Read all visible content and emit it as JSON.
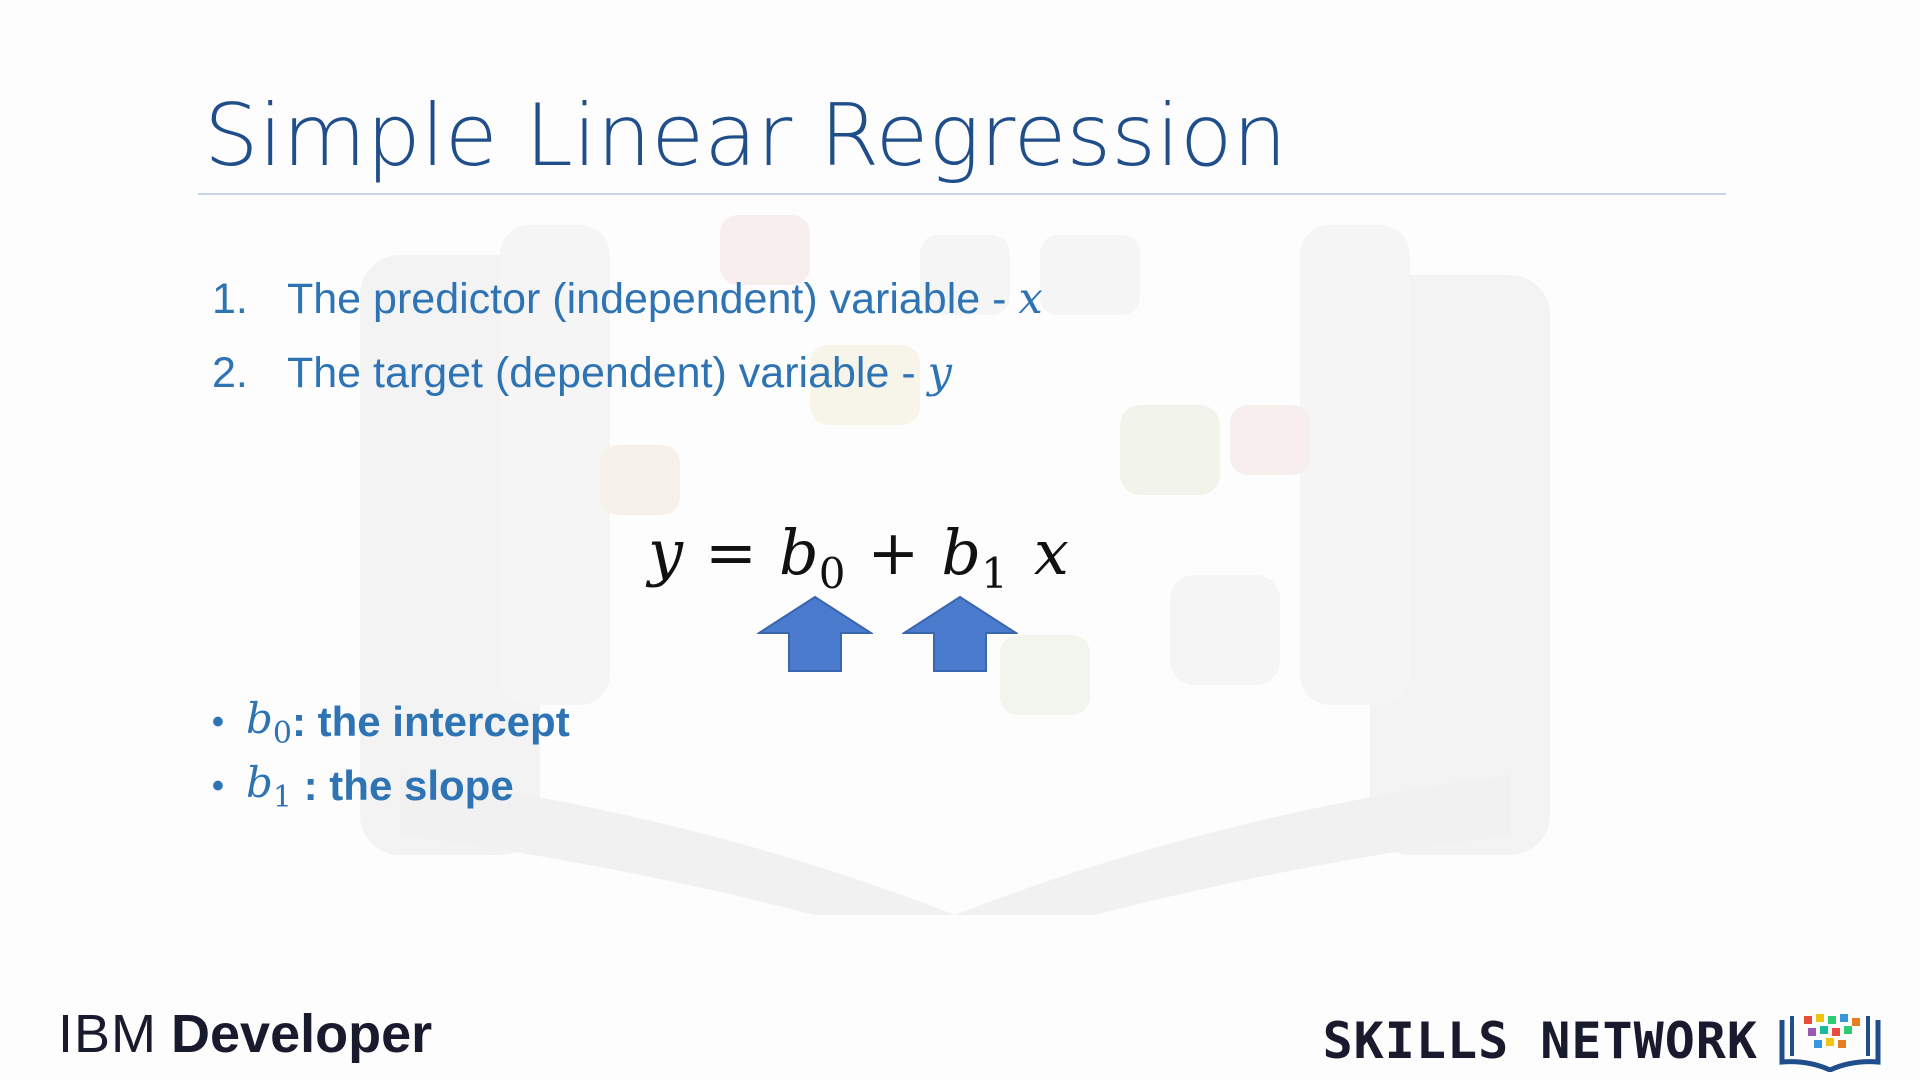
{
  "slide": {
    "title": "Simple Linear Regression",
    "list": [
      {
        "number": "1.",
        "text": "The predictor (independent) variable - ",
        "var": "x"
      },
      {
        "number": "2.",
        "text": "The target (dependent) variable - ",
        "var": "y"
      }
    ],
    "equation": {
      "lhs": "y",
      "equals": "=",
      "b0_base": "b",
      "b0_sub": "0",
      "plus": "+",
      "b1_base": "b",
      "b1_sub": "1",
      "x": "x"
    },
    "bullets": [
      {
        "sym_base": "b",
        "sym_sub": "0",
        "text": ": the intercept"
      },
      {
        "sym_base": "b",
        "sym_sub": "1",
        "text": " : the slope"
      }
    ]
  },
  "footer": {
    "ibm_light": "IBM",
    "ibm_bold": "Developer",
    "skills_network": "SKILLS NETWORK"
  },
  "colors": {
    "title": "#1f4e8a",
    "text": "#2e74b5",
    "arrow": "#4a7bcc",
    "rule": "#c9d6ea"
  },
  "icons": [
    "up-arrow-icon",
    "skills-network-book-icon"
  ]
}
